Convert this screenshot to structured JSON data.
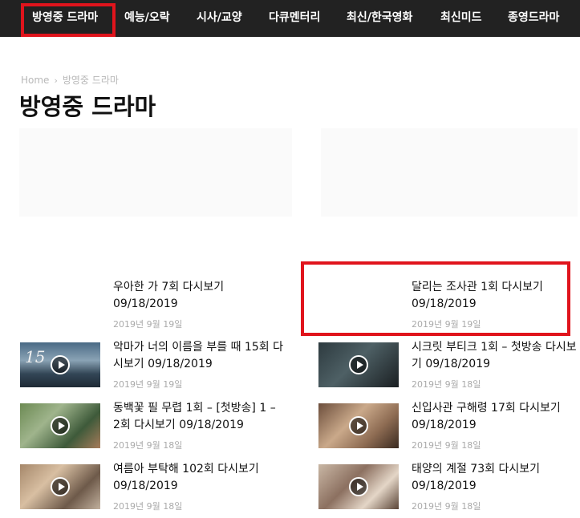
{
  "nav": {
    "items": [
      "방영중 드라마",
      "예능/오락",
      "시사/교양",
      "다큐멘터리",
      "최신/한국영화",
      "최신미드",
      "종영드라마"
    ]
  },
  "breadcrumb": {
    "home": "Home",
    "separator": "›",
    "current": "방영중 드라마"
  },
  "page_title": "방영중 드라마",
  "posts": [
    {
      "title": "우아한 가 7회 다시보기 09/18/2019",
      "date": "2019년 9월 19일"
    },
    {
      "title": "달리는 조사관 1회 다시보기 09/18/2019",
      "date": "2019년 9월 19일"
    },
    {
      "title": "악마가 너의 이름을 부를 때 15회 다시보기 09/18/2019",
      "date": "2019년 9월 19일",
      "thumb_text": "15"
    },
    {
      "title": "시크릿 부티크 1회 – 첫방송 다시보기 09/18/2019",
      "date": "2019년 9월 18일"
    },
    {
      "title": "동백꽃 필 무렵 1회 – [첫방송] 1 – 2회 다시보기 09/18/2019",
      "date": "2019년 9월 18일"
    },
    {
      "title": "신입사관 구해령 17회 다시보기 09/18/2019",
      "date": "2019년 9월 18일"
    },
    {
      "title": "여름아 부탁해 102회 다시보기 09/18/2019",
      "date": "2019년 9월 18일"
    },
    {
      "title": "태양의 계절 73회 다시보기 09/18/2019",
      "date": "2019년 9월 18일"
    }
  ],
  "colors": {
    "nav_bg": "#222222",
    "highlight": "#e0141c",
    "meta": "#aaaaaa"
  }
}
